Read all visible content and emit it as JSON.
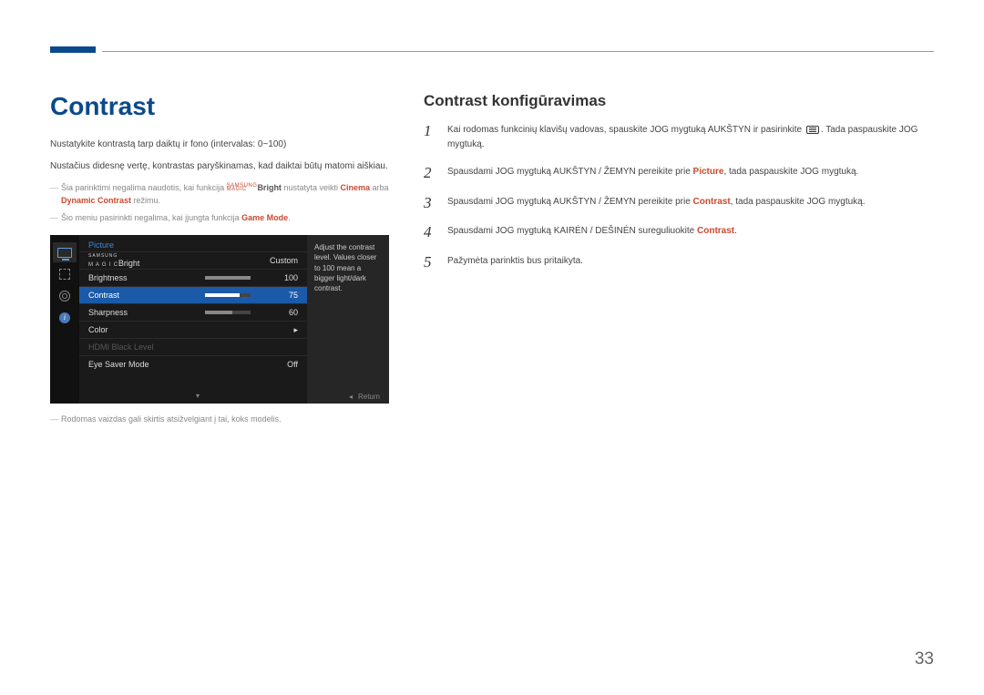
{
  "page_number": "33",
  "left": {
    "title": "Contrast",
    "p1": "Nustatykite kontrastą tarp daiktų ir fono (intervalas: 0~100)",
    "p2": "Nustačius didesnę vertę, kontrastas paryškinamas, kad daiktai būtų matomi aiškiau.",
    "note1_a": "Šia parinktimi negalima naudotis, kai funkcija ",
    "note1_magic_sup": "SAMSUNG",
    "note1_magic": "MAGIC",
    "note1_bright": "Bright",
    "note1_b": " nustatyta veikti ",
    "note1_cinema": "Cinema",
    "note1_or": " arba ",
    "note1_dynamic": "Dynamic Contrast",
    "note1_c": " režimu.",
    "note2_a": "Šio meniu pasirinkti negalima, kai įjungta funkcija ",
    "note2_game": "Game Mode",
    "note2_b": ".",
    "disclaimer": "Rodomas vaizdas gali skirtis atsižvelgiant į tai, koks modelis."
  },
  "osd": {
    "title": "Picture",
    "magic_sup": "SAMSUNG",
    "magic_sub": "M A G I C",
    "magic_right": "Bright",
    "magic_value": "Custom",
    "brightness_label": "Brightness",
    "brightness_value": "100",
    "contrast_label": "Contrast",
    "contrast_value": "75",
    "sharpness_label": "Sharpness",
    "sharpness_value": "60",
    "color_label": "Color",
    "hdmi_label": "HDMI Black Level",
    "eyesaver_label": "Eye Saver Mode",
    "eyesaver_value": "Off",
    "desc": "Adjust the contrast level. Values closer to 100 mean a bigger light/dark contrast.",
    "return": "Return"
  },
  "right": {
    "title": "Contrast konfigūravimas",
    "steps": [
      {
        "n": "1",
        "a": "Kai rodomas funkcinių klavišų vadovas, spauskite JOG mygtuką AUKŠTYN ir pasirinkite ",
        "b": ". Tada paspauskite JOG mygtuką."
      },
      {
        "n": "2",
        "a": "Spausdami JOG mygtuką AUKŠTYN / ŽEMYN pereikite prie ",
        "hl": "Picture",
        "b": ", tada paspauskite JOG mygtuką."
      },
      {
        "n": "3",
        "a": "Spausdami JOG mygtuką AUKŠTYN / ŽEMYN pereikite prie ",
        "hl": "Contrast",
        "b": ", tada paspauskite JOG mygtuką."
      },
      {
        "n": "4",
        "a": "Spausdami JOG mygtuką KAIRĖN / DEŠINĖN sureguliuokite ",
        "hl": "Contrast",
        "b": "."
      },
      {
        "n": "5",
        "a": "Pažymėta parinktis bus pritaikyta."
      }
    ]
  }
}
